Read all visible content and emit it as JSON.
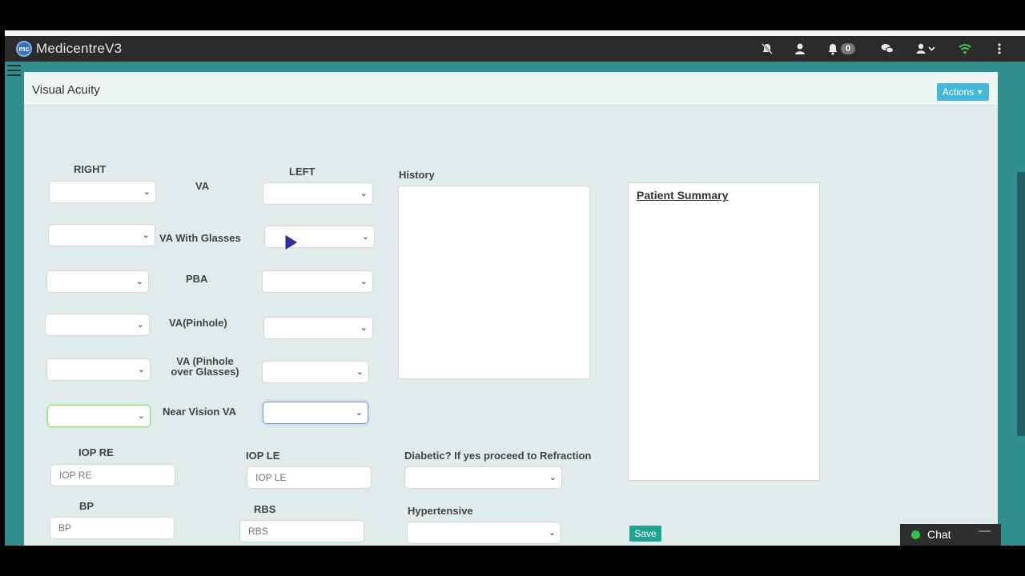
{
  "app": {
    "logo_text": "mc",
    "name": "MedicentreV3",
    "notification_count": "0",
    "icons": [
      "mute-icon",
      "user-badge-icon",
      "bell-icon",
      "chat-bubbles-icon",
      "user-menu-icon",
      "wifi-icon",
      "kebab-menu-icon"
    ]
  },
  "panel": {
    "title": "Visual Acuity",
    "actions_label": "Actions"
  },
  "acuity": {
    "right_header": "RIGHT",
    "left_header": "LEFT",
    "rows": [
      "VA",
      "VA With Glasses",
      "PBA",
      "VA(Pinhole)",
      "VA (Pinhole over Glasses)",
      "Near Vision VA"
    ]
  },
  "history_label": "History",
  "summary_title": "Patient Summary",
  "fields": {
    "iop_re": {
      "label": "IOP RE",
      "placeholder": "IOP RE"
    },
    "iop_le": {
      "label": "IOP LE",
      "placeholder": "IOP LE"
    },
    "bp": {
      "label": "BP",
      "placeholder": "BP"
    },
    "rbs": {
      "label": "RBS",
      "placeholder": "RBS"
    },
    "diabetic_label": "Diabetic? If  yes proceed to Refraction",
    "hypertensive_label": "Hypertensive"
  },
  "save_label": "Save",
  "chat": {
    "label": "Chat",
    "minimize": "—"
  },
  "colors": {
    "teal": "#2f8e8e",
    "actions": "#45b8d8",
    "save": "#1fa393",
    "navbar": "#2b2b2b"
  }
}
